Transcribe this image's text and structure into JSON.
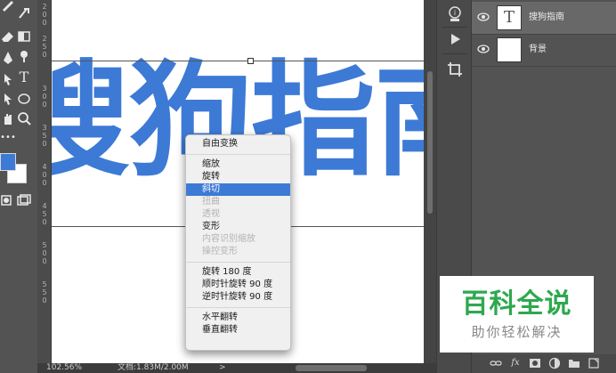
{
  "toolbar": {
    "icons": [
      "brush-icon",
      "smudge-icon",
      "eraser-icon",
      "rectangle-icon",
      "pen-icon",
      "type-icon",
      "path-select-icon",
      "ellipse-icon",
      "hand-icon",
      "zoom-icon",
      "more-icon",
      "quickmask-icon",
      "screenmode-icon"
    ],
    "type_glyph": "T",
    "foreground_color": "#3d7ad6",
    "background_color": "#ffffff"
  },
  "ruler": {
    "labels": [
      "2",
      "0",
      "0",
      "2",
      "5",
      "0",
      "3",
      "0",
      "0",
      "3",
      "5",
      "0",
      "4",
      "0",
      "0",
      "4",
      "5",
      "0",
      "5",
      "0",
      "0",
      "5",
      "5",
      "0"
    ]
  },
  "canvas": {
    "text_content": "搜狗指南",
    "text_color": "#3d7ad6"
  },
  "statusbar": {
    "zoom": "102.56%",
    "doc_info": "文档:1.83M/2.00M",
    "arrow": ">"
  },
  "context_menu": {
    "groups": [
      [
        {
          "label": "自由变换",
          "state": "normal"
        }
      ],
      [
        {
          "label": "缩放",
          "state": "normal"
        },
        {
          "label": "旋转",
          "state": "normal"
        },
        {
          "label": "斜切",
          "state": "highlight"
        },
        {
          "label": "扭曲",
          "state": "disabled"
        },
        {
          "label": "透视",
          "state": "disabled"
        },
        {
          "label": "变形",
          "state": "normal"
        },
        {
          "label": "内容识别缩放",
          "state": "disabled"
        },
        {
          "label": "操控变形",
          "state": "disabled"
        }
      ],
      [
        {
          "label": "旋转 180 度",
          "state": "normal"
        },
        {
          "label": "顺时针旋转 90 度",
          "state": "normal"
        },
        {
          "label": "逆时针旋转 90 度",
          "state": "normal"
        }
      ],
      [
        {
          "label": "水平翻转",
          "state": "normal"
        },
        {
          "label": "垂直翻转",
          "state": "normal"
        }
      ]
    ],
    "highlight_color": "#3d7ad6"
  },
  "icon_strip": {
    "icons": [
      "info-icon",
      "play-icon",
      "crop-icon"
    ]
  },
  "layers": {
    "items": [
      {
        "name": "搜狗指南",
        "thumb": "T",
        "selected": true
      },
      {
        "name": "背景",
        "thumb": "",
        "selected": false
      }
    ],
    "footer_icons": [
      "link-icon",
      "fx-icon",
      "mask-icon",
      "adjustment-icon",
      "folder-icon",
      "new-layer-icon"
    ],
    "fx_label": "fx"
  },
  "watermark": {
    "title": "百科全说",
    "subtitle": "助你轻松解决",
    "title_color": "#2ea84f"
  }
}
